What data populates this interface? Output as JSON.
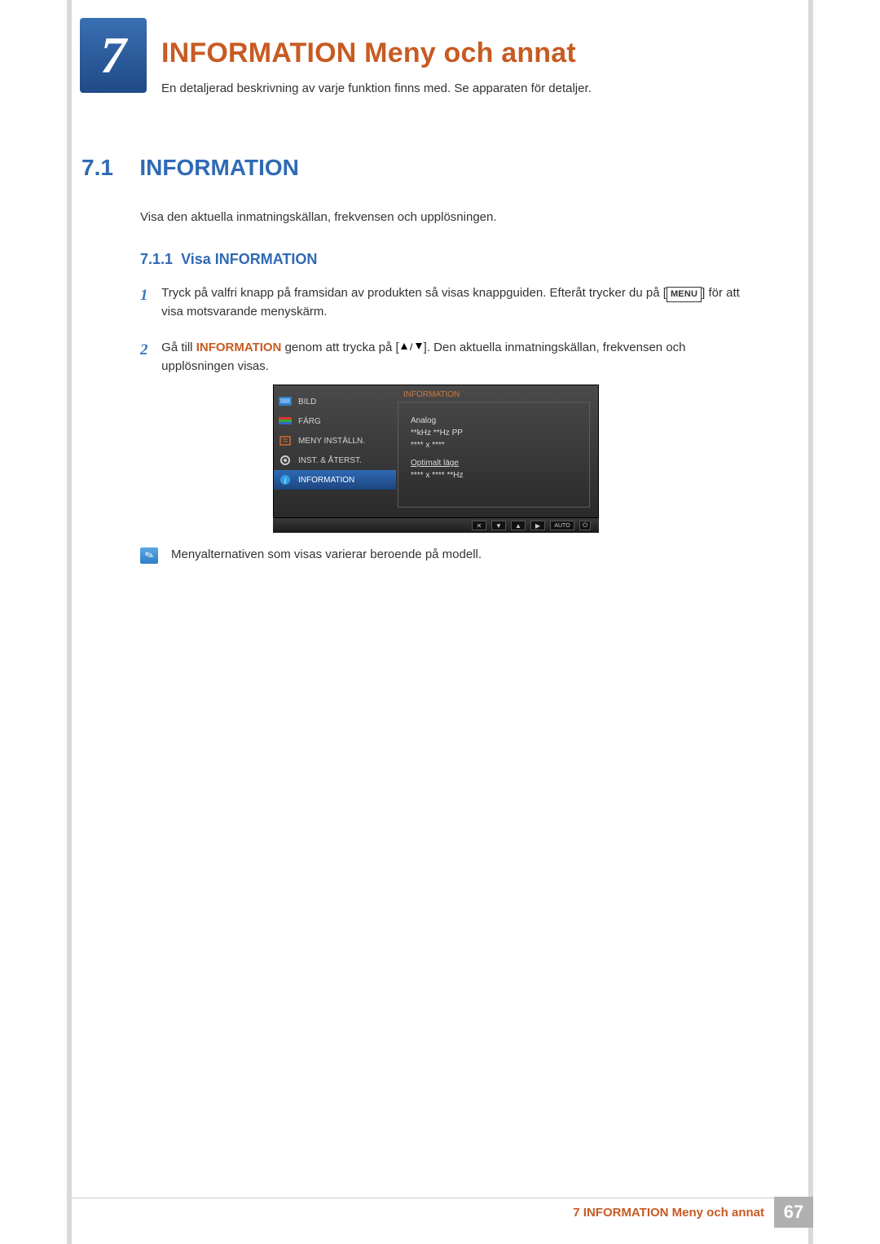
{
  "chapter": {
    "num": "7",
    "title": "INFORMATION Meny och annat",
    "subtitle": "En detaljerad beskrivning av varje funktion finns med. Se apparaten för detaljer."
  },
  "section": {
    "num": "7.1",
    "title": "INFORMATION",
    "desc": "Visa den aktuella inmatningskällan, frekvensen och upplösningen."
  },
  "subsection": {
    "num": "7.1.1",
    "title": "Visa INFORMATION"
  },
  "steps": {
    "s1": {
      "num": "1",
      "pre": "Tryck på valfri knapp på framsidan av produkten så visas knappguiden. Efteråt trycker du på [",
      "menu": "MENU",
      "post": "] för att visa motsvarande menyskärm."
    },
    "s2": {
      "num": "2",
      "pre": "Gå till ",
      "kw": "INFORMATION",
      "mid": " genom att trycka på [",
      "post": "]. Den aktuella inmatningskällan, frekvensen och upplösningen visas."
    }
  },
  "osd": {
    "title": "INFORMATION",
    "items": {
      "bild": "BILD",
      "farg": "FÄRG",
      "meny": "MENY INSTÄLLN.",
      "inst": "INST. & ÅTERST.",
      "info": "INFORMATION"
    },
    "panel": {
      "l1": "Analog",
      "l2": "**kHz **Hz PP",
      "l3": "**** x ****",
      "opt1": "Optimalt läge",
      "opt2": "**** x **** **Hz"
    },
    "auto": "AUTO"
  },
  "note": "Menyalternativen som visas varierar beroende på modell.",
  "footer": {
    "label": "7 INFORMATION Meny och annat",
    "page": "67"
  }
}
